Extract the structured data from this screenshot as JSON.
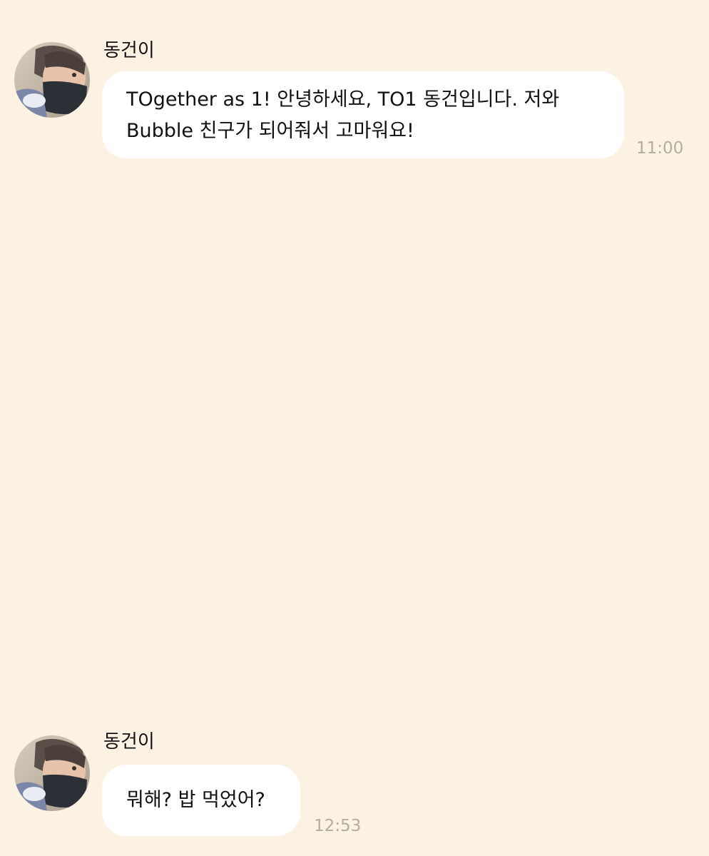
{
  "messages": [
    {
      "sender": "동건이",
      "text": "TOgether as 1! 안녕하세요, TO1 동건입니다. 저와\nBubble 친구가 되어줘서 고마워요!",
      "time": "11:00"
    },
    {
      "sender": "동건이",
      "text": "뭐해? 밥 먹었어?",
      "time": "12:53"
    }
  ],
  "icons": {
    "avatar": "profile-photo"
  },
  "colors": {
    "background": "#fcf2e3",
    "bubble": "#ffffff",
    "time": "#b3aca2"
  }
}
